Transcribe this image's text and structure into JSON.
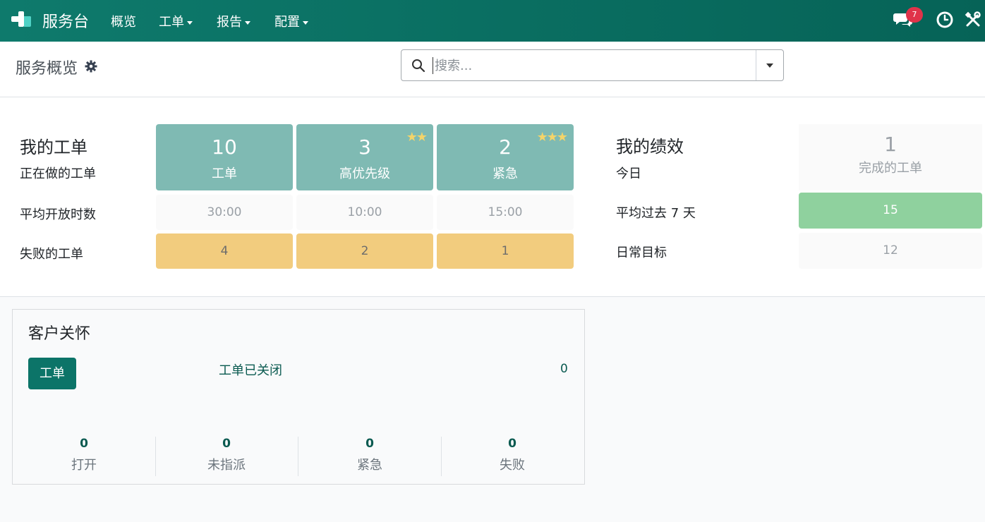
{
  "app": {
    "title": "服务台"
  },
  "nav": {
    "items": [
      {
        "label": "概览",
        "dropdown": false
      },
      {
        "label": "工单",
        "dropdown": true
      },
      {
        "label": "报告",
        "dropdown": true
      },
      {
        "label": "配置",
        "dropdown": true
      }
    ],
    "icons": [
      "chat-icon",
      "clock-icon",
      "tools-icon"
    ],
    "messages_badge": "7"
  },
  "control_panel": {
    "title": "服务概览",
    "search": {
      "placeholder": "搜索..."
    }
  },
  "my_tickets": {
    "title": "我的工单",
    "row_labels": {
      "in_progress": "正在做的工单",
      "avg_open": "平均开放时数",
      "failed": "失败的工单"
    },
    "columns": [
      {
        "count": "10",
        "label": "工单",
        "stars": "",
        "avg_open": "30:00",
        "failed": "4"
      },
      {
        "count": "3",
        "label": "高优先级",
        "stars": "★★",
        "avg_open": "10:00",
        "failed": "2"
      },
      {
        "count": "2",
        "label": "紧急",
        "stars": "★★★",
        "avg_open": "15:00",
        "failed": "1"
      }
    ]
  },
  "my_performance": {
    "title": "我的绩效",
    "today_label": "今日",
    "today_value": "1",
    "today_caption": "完成的工单",
    "avg7_label": "平均过去 7 天",
    "avg7_value": "15",
    "daily_goal_label": "日常目标",
    "daily_goal_value": "12"
  },
  "team_card": {
    "title": "客户关怀",
    "button_label": "工单",
    "closed_label": "工单已关闭",
    "closed_count": "0",
    "stats": [
      {
        "value": "0",
        "label": "打开"
      },
      {
        "value": "0",
        "label": "未指派"
      },
      {
        "value": "0",
        "label": "紧急"
      },
      {
        "value": "0",
        "label": "失败"
      }
    ]
  },
  "colors": {
    "navbar": "#0e7a6c",
    "tile": "#7fbab3",
    "warning": "#f2cc7e",
    "success": "#8fd19e",
    "badge": "#e0334a",
    "primary_button": "#0c7468"
  }
}
